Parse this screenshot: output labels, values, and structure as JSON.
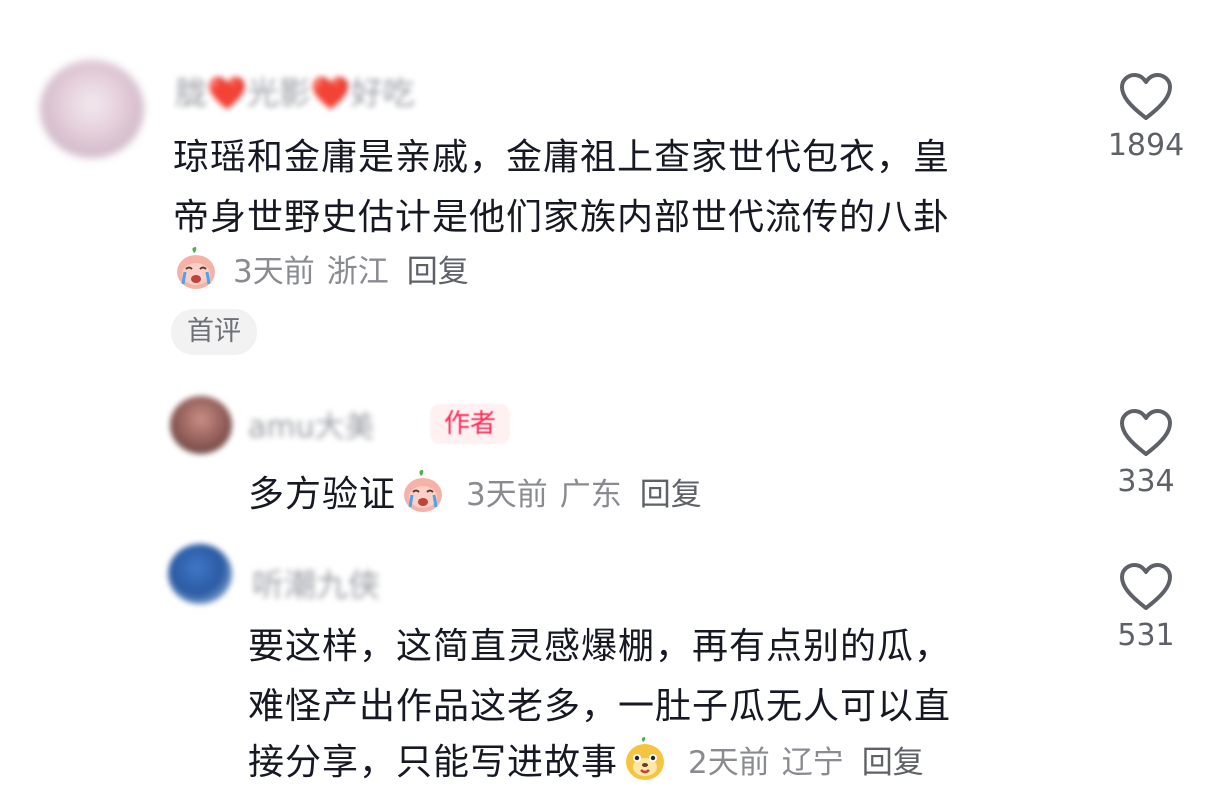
{
  "comments": [
    {
      "username": "胧❤️光影❤️好吃",
      "text_lines": [
        "琼瑶和金庸是亲戚，金庸祖上查家世代包衣，皇",
        "帝身世野史估计是他们家族内部世代流传的八卦"
      ],
      "sticker": "crying-peach-sticker",
      "time": "3天前",
      "location": "浙江",
      "reply_label": "回复",
      "badge": "首评",
      "likes": "1894"
    },
    {
      "username": "amu大美",
      "author_tag": "作者",
      "text": "多方验证",
      "sticker": "crying-peach-sticker",
      "time": "3天前",
      "location": "广东",
      "reply_label": "回复",
      "likes": "334"
    },
    {
      "username": "听潮九侠",
      "text_lines": [
        "要这样，这简直灵感爆棚，再有点别的瓜，",
        "难怪产出作品这老多，一肚子瓜无人可以直",
        "接分享，只能写进故事"
      ],
      "sticker": "dog-face-sticker",
      "time": "2天前",
      "location": "辽宁",
      "reply_label": "回复",
      "likes": "531"
    }
  ],
  "colors": {
    "text": "#161823",
    "meta": "#8a8b91",
    "author_tag": "#ff2c55",
    "chip_bg": "#f2f2f3"
  },
  "icons": [
    "heart-outline-icon"
  ]
}
